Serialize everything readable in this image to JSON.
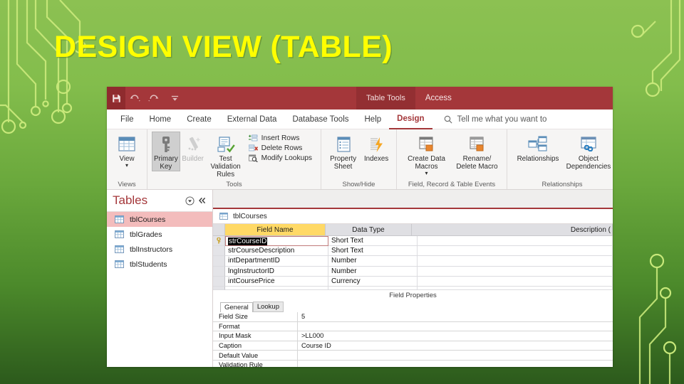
{
  "slide": {
    "title": "DESIGN VIEW (TABLE)",
    "title_color": "#ffff00",
    "bg_top_color": "#8cc152",
    "bg_bottom_color": "#2c5a1c",
    "accent_color": "#c8e87a"
  },
  "access": {
    "titlebar": {
      "color": "#a4373a",
      "save_label": "Save",
      "undo_label": "Undo",
      "redo_label": "Redo",
      "customize_label": "Customize Quick Access Toolbar",
      "context_group": "Table Tools",
      "app_name": "Access"
    },
    "tabs": [
      {
        "label": "File",
        "active": false
      },
      {
        "label": "Home",
        "active": false
      },
      {
        "label": "Create",
        "active": false
      },
      {
        "label": "External Data",
        "active": false
      },
      {
        "label": "Database Tools",
        "active": false
      },
      {
        "label": "Help",
        "active": false
      },
      {
        "label": "Design",
        "active": true
      }
    ],
    "tellme": {
      "icon": "search-icon",
      "text": "Tell me what you want to"
    },
    "ribbon": {
      "groups": [
        {
          "name": "Views",
          "label": "Views",
          "big_buttons": [
            {
              "label": "View",
              "icon": "datasheet-view-icon",
              "has_dropdown": true,
              "state": "normal"
            }
          ],
          "small_buttons": []
        },
        {
          "name": "Tools",
          "label": "Tools",
          "big_buttons": [
            {
              "label": "Primary Key",
              "icon": "key-icon",
              "has_dropdown": false,
              "state": "selected"
            },
            {
              "label": "Builder",
              "icon": "builder-wand-icon",
              "has_dropdown": false,
              "state": "disabled"
            },
            {
              "label": "Test Validation Rules",
              "icon": "validation-rules-icon",
              "has_dropdown": false,
              "state": "normal"
            }
          ],
          "small_buttons": [
            {
              "label": "Insert Rows",
              "icon": "insert-rows-icon"
            },
            {
              "label": "Delete Rows",
              "icon": "delete-rows-icon"
            },
            {
              "label": "Modify Lookups",
              "icon": "modify-lookups-icon"
            }
          ]
        },
        {
          "name": "Show/Hide",
          "label": "Show/Hide",
          "big_buttons": [
            {
              "label": "Property Sheet",
              "icon": "property-sheet-icon",
              "has_dropdown": false,
              "state": "normal"
            },
            {
              "label": "Indexes",
              "icon": "indexes-icon",
              "has_dropdown": false,
              "state": "normal"
            }
          ],
          "small_buttons": []
        },
        {
          "name": "Field, Record & Table Events",
          "label": "Field, Record & Table Events",
          "big_buttons": [
            {
              "label": "Create Data Macros",
              "icon": "create-data-macros-icon",
              "has_dropdown": true,
              "state": "normal"
            },
            {
              "label": "Rename/ Delete Macro",
              "icon": "rename-delete-macro-icon",
              "has_dropdown": false,
              "state": "normal"
            }
          ],
          "small_buttons": []
        },
        {
          "name": "Relationships",
          "label": "Relationships",
          "big_buttons": [
            {
              "label": "Relationships",
              "icon": "relationships-icon",
              "has_dropdown": false,
              "state": "normal"
            },
            {
              "label": "Object Dependencies",
              "icon": "object-dependencies-icon",
              "has_dropdown": false,
              "state": "normal"
            }
          ],
          "small_buttons": []
        }
      ]
    },
    "navpane": {
      "title": "Tables",
      "menu_icon": "chevron-down-circle-icon",
      "collapse_icon": "double-chevron-left-icon",
      "items": [
        {
          "label": "tblCourses",
          "icon": "table-icon",
          "selected": true
        },
        {
          "label": "tblGrades",
          "icon": "table-icon",
          "selected": false
        },
        {
          "label": "tblInstructors",
          "icon": "table-icon",
          "selected": false
        },
        {
          "label": "tblStudents",
          "icon": "table-icon",
          "selected": false
        }
      ]
    },
    "document": {
      "tab_label": "tblCourses",
      "tab_icon": "table-icon",
      "grid": {
        "headers": {
          "field_name": "Field Name",
          "data_type": "Data Type",
          "description": "Description ("
        },
        "rows": [
          {
            "field": "strCourseID",
            "type": "Short Text",
            "description": "",
            "primary_key": true,
            "active": true,
            "selected_text": true
          },
          {
            "field": "strCourseDescription",
            "type": "Short Text",
            "description": "",
            "primary_key": false,
            "active": false,
            "selected_text": false
          },
          {
            "field": "intDepartmentID",
            "type": "Number",
            "description": "",
            "primary_key": false,
            "active": false,
            "selected_text": false
          },
          {
            "field": "lngInstructorID",
            "type": "Number",
            "description": "",
            "primary_key": false,
            "active": false,
            "selected_text": false
          },
          {
            "field": "intCoursePrice",
            "type": "Currency",
            "description": "",
            "primary_key": false,
            "active": false,
            "selected_text": false
          }
        ]
      },
      "field_properties": {
        "title": "Field Properties",
        "tabs": [
          {
            "label": "General",
            "active": true
          },
          {
            "label": "Lookup",
            "active": false
          }
        ],
        "rows": [
          {
            "label": "Field Size",
            "value": "5"
          },
          {
            "label": "Format",
            "value": ""
          },
          {
            "label": "Input Mask",
            "value": ">LL000"
          },
          {
            "label": "Caption",
            "value": "Course ID"
          },
          {
            "label": "Default Value",
            "value": ""
          },
          {
            "label": "Validation Rule",
            "value": ""
          }
        ]
      }
    }
  }
}
